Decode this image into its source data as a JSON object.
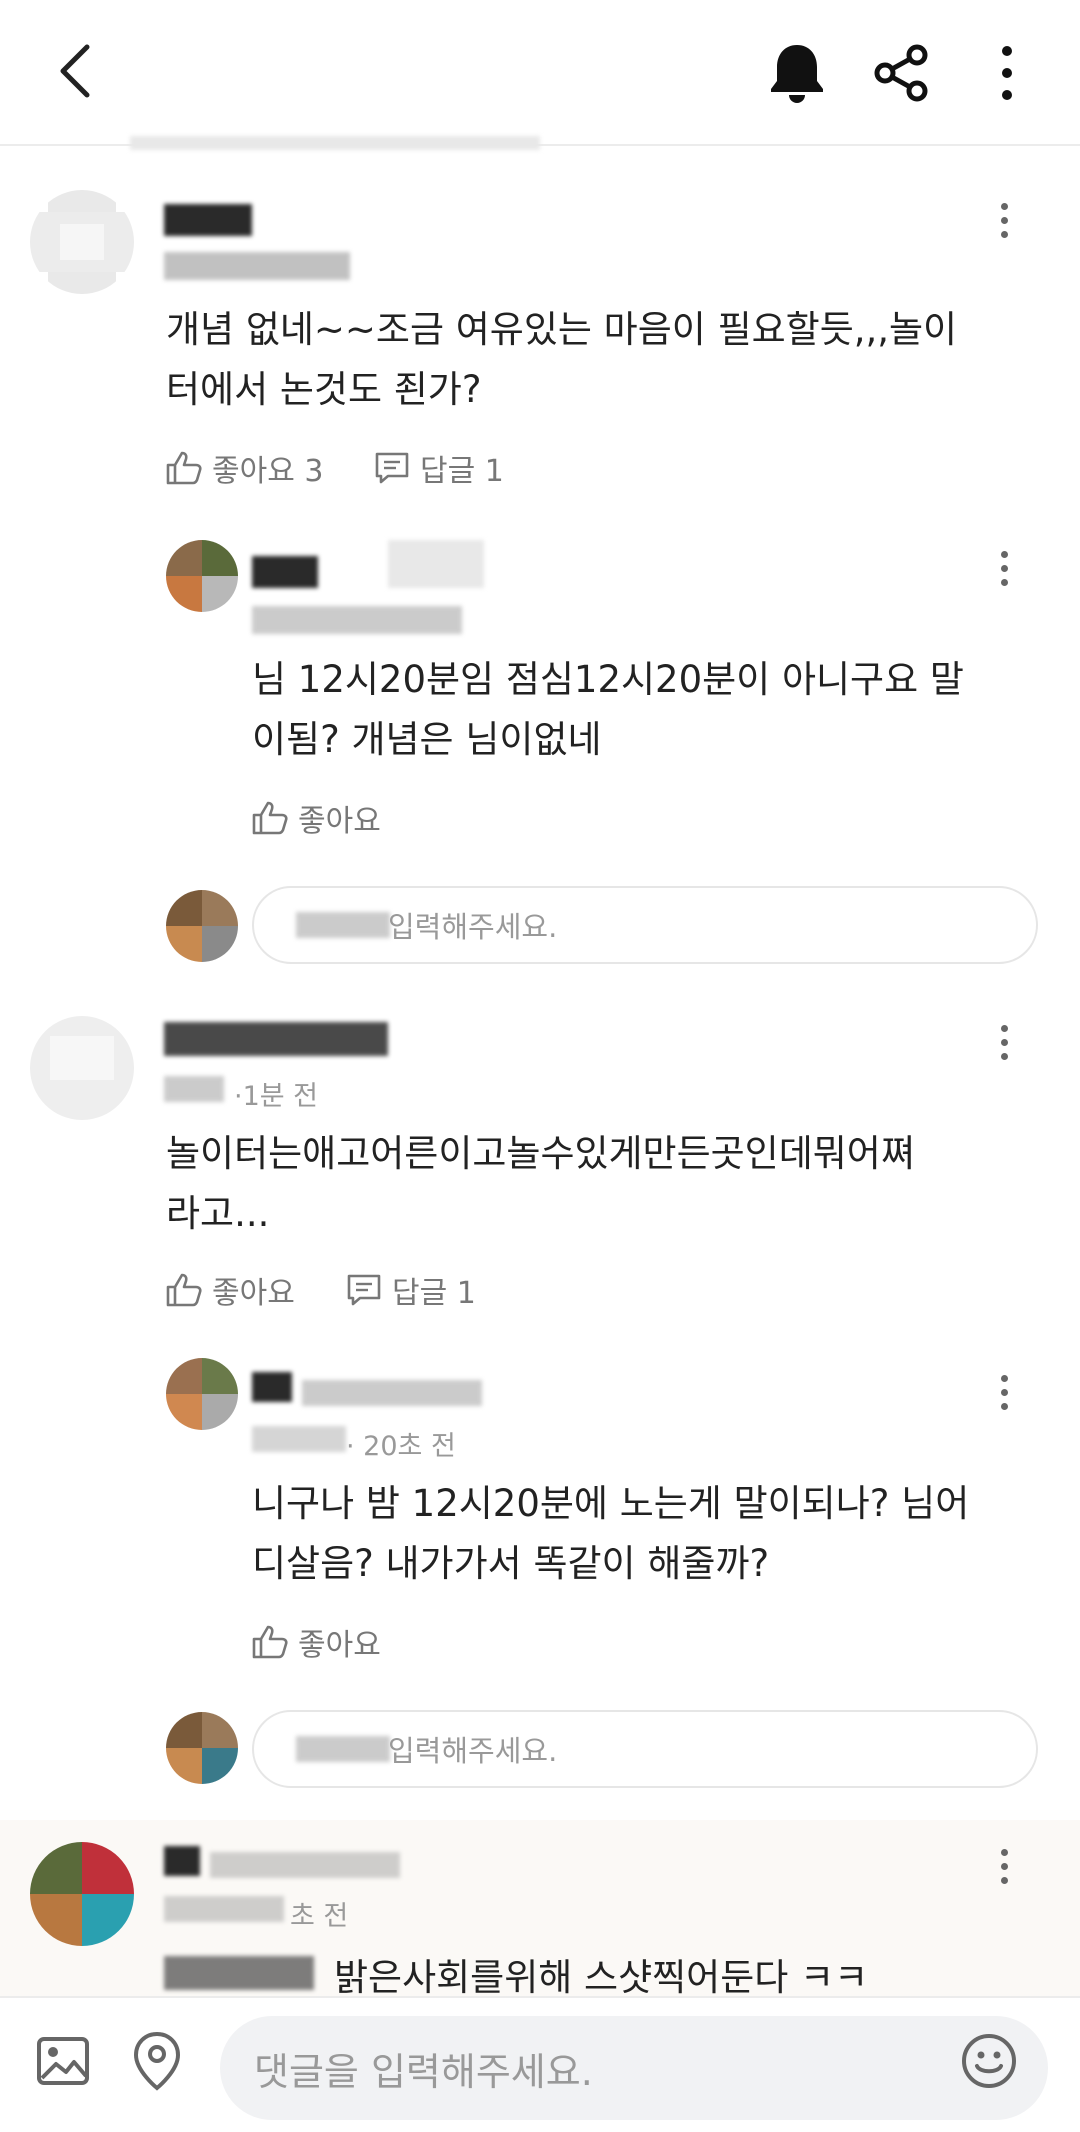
{
  "comments": [
    {
      "body_line1": "개념 없네~~조금 여유있는 마음이 필요할듯,,,놀이",
      "body_line2": "터에서 논것도 죈가?",
      "like_label": "좋아요 3",
      "reply_label": "답글 1",
      "replies": [
        {
          "body_line1": "님 12시20분임 점심12시20분이 아니구요 말",
          "body_line2": "이됨? 개념은 님이없네",
          "like_label": "좋아요"
        }
      ],
      "reply_input_placeholder": "입력해주세요."
    },
    {
      "meta": "·1분 전",
      "body_line1": "놀이터는애고어른이고놀수있게만든곳인데뭐어쪄",
      "body_line2": "라고...",
      "like_label": "좋아요",
      "reply_label": "답글 1",
      "replies": [
        {
          "meta": "· 20초 전",
          "body_line1": "니구나 밤 12시20분에 노는게 말이되나? 님어",
          "body_line2": "디살음? 내가가서 똑같이 해줄까?",
          "like_label": "좋아요"
        }
      ],
      "reply_input_placeholder": "입력해주세요."
    },
    {
      "meta": "초 전",
      "body_line1": "밝은사회를위해 스샷찍어둔다 ㅋㅋ"
    }
  ],
  "bottom_bar": {
    "input_placeholder": "댓글을 입력해주세요."
  },
  "icons": {
    "back": "chevron-left-icon",
    "bell": "bell-icon",
    "share": "share-icon",
    "more": "more-vertical-icon",
    "like": "thumbs-up-icon",
    "reply": "comment-icon",
    "image": "image-icon",
    "location": "location-pin-icon",
    "emoji": "smiley-icon"
  }
}
